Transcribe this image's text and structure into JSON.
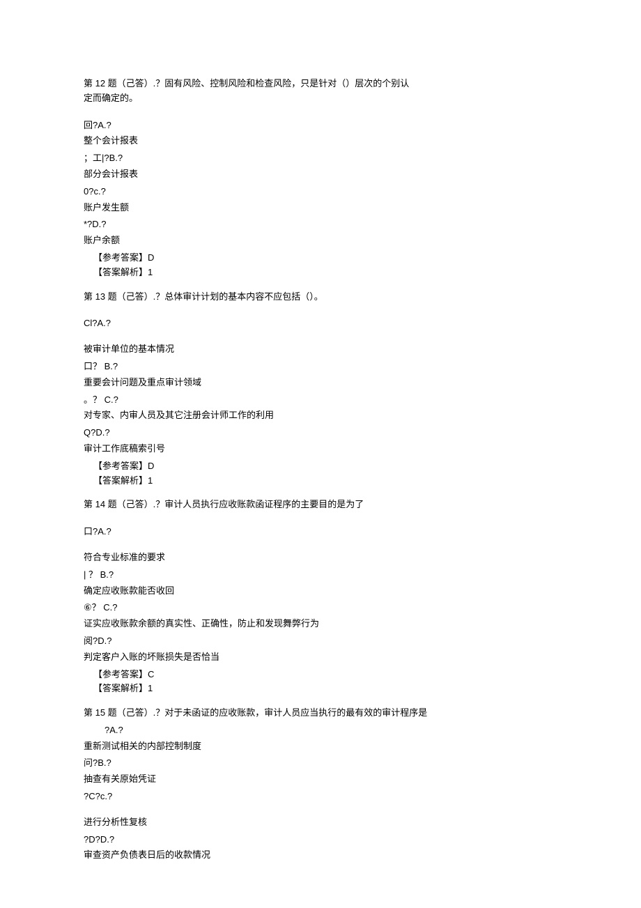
{
  "q12": {
    "intro_line1": "第 12 题（己答）.？固有风险、控制风险和检查风险，只是针对（）层次的个别认",
    "intro_line2": "定而确定的。",
    "optA_marker": "回?A.?",
    "optA_text": "整个会计报表",
    "optB_marker": "；工|?B.?",
    "optB_text": "部分会计报表",
    "optC_marker": "0?c.?",
    "optC_text": "账户发生额",
    "optD_marker": "  *?D.?",
    "optD_text": "账户余额",
    "ref_answer": "【参考答案】D",
    "analysis": "【答案解析】1"
  },
  "q13": {
    "intro": "第 13 题（己答）.？总体审计计划的基本内容不应包括（）。",
    "optA_marker": "Cl?A.?",
    "optA_text": "被审计单位的基本情况",
    "optB_marker": "口？ B.?",
    "optB_text": "重要会计问题及重点审计领域",
    "optC_marker": "。？ C.?",
    "optC_text": "对专家、内审人员及其它注册会计师工作的利用",
    "optD_marker": "Q?D.?",
    "optD_text": "审计工作底稿索引号",
    "ref_answer": "【参考答案】D",
    "analysis": "【答案解析】1"
  },
  "q14": {
    "intro": "第 14 题（己答）.？审计人员执行应收账款函证程序的主要目的是为了",
    "optA_marker": "口?A.?",
    "optA_text": "符合专业标准的要求",
    "optB_marker": " | ？ B.?",
    "optB_text": "确定应收账款能否收回",
    "optC_marker": "⑥？ C.?",
    "optC_text": "证实应收账款余额的真实性、正确性，防止和发现舞弊行为",
    "optD_marker": "阅?D.?",
    "optD_text": "判定客户入账的坏账损失是否恰当",
    "ref_answer": "【参考答案】C",
    "analysis": "【答案解析】1"
  },
  "q15": {
    "intro": "第 15 题（己答）.？对于未函证的应收账款，审计人员应当执行的最有效的审计程序是",
    "optA_marker": "?A.?",
    "optA_text": "重新测试相关的内部控制制度",
    "optB_marker": "问?B.?",
    "optB_text": "抽查有关原始凭证",
    "optC_marker": "?C?c.?",
    "optC_text": "进行分析性复核",
    "optD_marker": "?D?D.?",
    "optD_text": "审查资产负债表日后的收款情况"
  }
}
